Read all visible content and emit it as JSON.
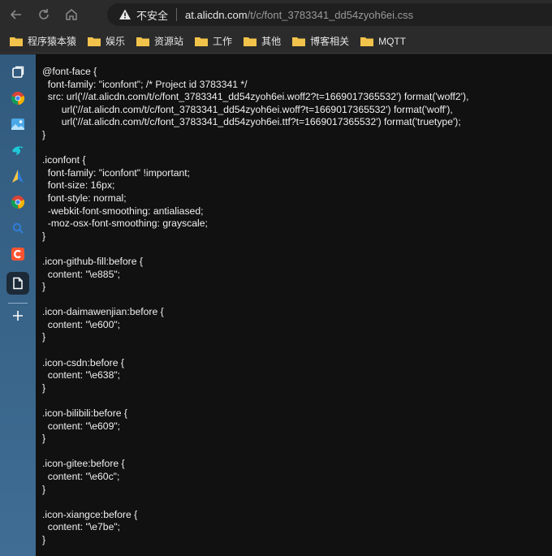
{
  "address_bar": {
    "security_label": "不安全",
    "url_host": "at.alicdn.com",
    "url_path": "/t/c/font_3783341_dd54zyoh6ei.css"
  },
  "bookmarks": [
    {
      "label": "程序猿本猿"
    },
    {
      "label": "娱乐"
    },
    {
      "label": "资源站"
    },
    {
      "label": "工作"
    },
    {
      "label": "其他"
    },
    {
      "label": "博客相关"
    },
    {
      "label": "MQTT"
    }
  ],
  "colors": {
    "folder": "#f2c34b",
    "sidebar_top": "#315a7d",
    "sidebar_bottom": "#3f6d94"
  },
  "sidebar_icons": [
    "tabs-icon",
    "chrome-icon",
    "photos-icon",
    "bird-app-icon",
    "navigation-icon",
    "chrome-icon-2",
    "search-app-icon",
    "csdn-icon",
    "document-icon",
    "add-icon"
  ],
  "content": {
    "css_text": "@font-face {\n  font-family: \"iconfont\"; /* Project id 3783341 */\n  src: url('//at.alicdn.com/t/c/font_3783341_dd54zyoh6ei.woff2?t=1669017365532') format('woff2'),\n       url('//at.alicdn.com/t/c/font_3783341_dd54zyoh6ei.woff?t=1669017365532') format('woff'),\n       url('//at.alicdn.com/t/c/font_3783341_dd54zyoh6ei.ttf?t=1669017365532') format('truetype');\n}\n\n.iconfont {\n  font-family: \"iconfont\" !important;\n  font-size: 16px;\n  font-style: normal;\n  -webkit-font-smoothing: antialiased;\n  -moz-osx-font-smoothing: grayscale;\n}\n\n.icon-github-fill:before {\n  content: \"\\e885\";\n}\n\n.icon-daimawenjian:before {\n  content: \"\\e600\";\n}\n\n.icon-csdn:before {\n  content: \"\\e638\";\n}\n\n.icon-bilibili:before {\n  content: \"\\e609\";\n}\n\n.icon-gitee:before {\n  content: \"\\e60c\";\n}\n\n.icon-xiangce:before {\n  content: \"\\e7be\";\n}"
  }
}
